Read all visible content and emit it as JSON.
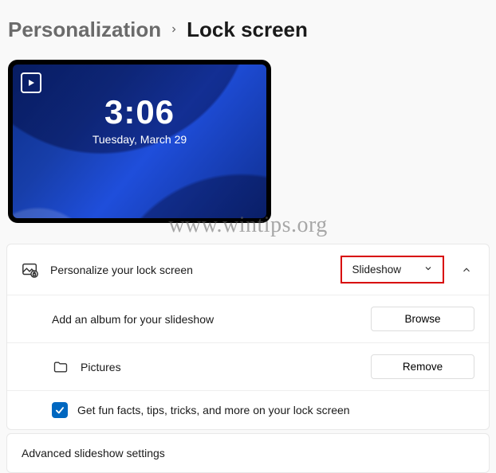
{
  "breadcrumb": {
    "parent": "Personalization",
    "current": "Lock screen"
  },
  "preview": {
    "time": "3:06",
    "date": "Tuesday, March 29"
  },
  "personalize": {
    "label": "Personalize your lock screen",
    "dropdown_value": "Slideshow"
  },
  "album": {
    "prompt": "Add an album for your slideshow",
    "browse": "Browse",
    "folder": "Pictures",
    "remove": "Remove"
  },
  "fun_facts": {
    "label": "Get fun facts, tips, tricks, and more on your lock screen",
    "checked": true
  },
  "advanced": {
    "label": "Advanced slideshow settings"
  },
  "watermark": "www.wintips.org"
}
